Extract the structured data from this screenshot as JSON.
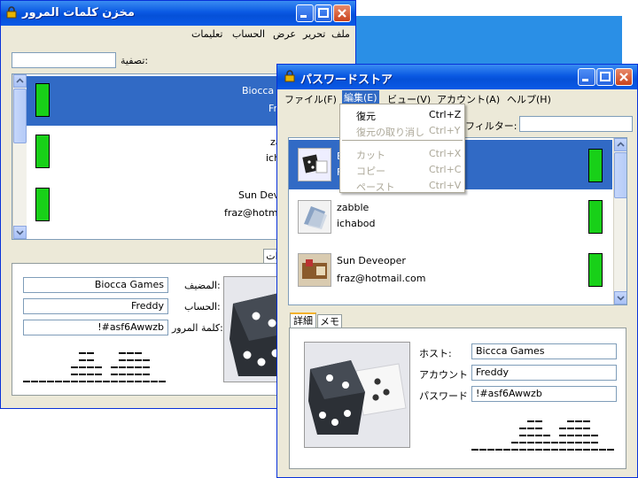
{
  "arabic_window": {
    "title": "مخزن كلمات المرور",
    "menu": [
      "ملف",
      "تحرير",
      "عرض",
      "الحساب",
      "تعليمات"
    ],
    "filter_label": "تصفية:",
    "filter_value": "",
    "list_rows": [
      {
        "line1": "Biocca G",
        "line2": "Fr",
        "selected": true
      },
      {
        "line1": "za",
        "line2": "icha",
        "selected": false
      },
      {
        "line1": "Sun Deveoper",
        "line2": "fraz@hotmail.",
        "selected": false
      }
    ],
    "tab_fragment": "ات",
    "host_label": "المضيف:",
    "host_value": "Biocca Games",
    "account_label": "الحساب:",
    "account_value": "Freddy",
    "password_label": "كلمة المرور:",
    "password_value": "!#asf6Awwzb",
    "strength_levels": [
      1,
      1,
      1,
      1,
      1,
      1,
      3,
      5,
      5,
      3,
      1,
      3,
      5,
      5,
      5,
      4,
      1,
      1
    ]
  },
  "japanese_window": {
    "title": "パスワードストア",
    "menu": [
      "ファイル(F)",
      "編集(E)",
      "ビュー(V)",
      "アカウント(A)",
      "ヘルプ(H)"
    ],
    "active_menu_index": 1,
    "filter_label": "フィルター:",
    "filter_value": "",
    "list_rows": [
      {
        "line1": "B",
        "line2": "F",
        "selected": true
      },
      {
        "line1": "zabble",
        "line2": "ichabod",
        "selected": false
      },
      {
        "line1": "Sun Deveoper",
        "line2": "fraz@hotmail.com",
        "selected": false
      }
    ],
    "tabs": [
      "詳細",
      "メモ"
    ],
    "host_label": "ホスト:",
    "host_value": "Biccca Games",
    "account_label": "アカウント",
    "account_value": "Freddy",
    "password_label": "パスワード",
    "password_value": "!#asf6Awwzb",
    "strength_levels": [
      1,
      1,
      1,
      1,
      1,
      2,
      4,
      5,
      5,
      3,
      2,
      4,
      5,
      5,
      5,
      3,
      1,
      1
    ]
  },
  "edit_menu": [
    {
      "label": "復元",
      "shortcut": "Ctrl+Z",
      "enabled": true
    },
    {
      "label": "復元の取り消し",
      "shortcut": "Ctrl+Y",
      "enabled": false
    },
    {
      "label": "カット",
      "shortcut": "Ctrl+X",
      "enabled": false
    },
    {
      "label": "コピー",
      "shortcut": "Ctrl+C",
      "enabled": false
    },
    {
      "label": "ペースト",
      "shortcut": "Ctrl+V",
      "enabled": false
    }
  ],
  "colors": {
    "titlebar": "#0a59e3",
    "selection": "#316ac5",
    "strength_bar": "#18d018",
    "window_face": "#ece9d8"
  }
}
